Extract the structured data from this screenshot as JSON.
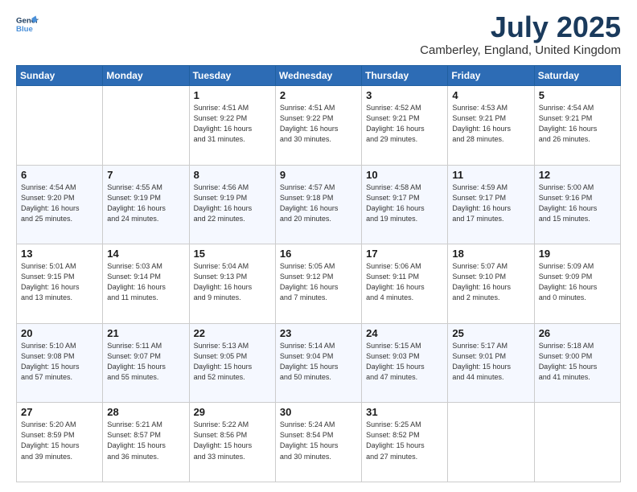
{
  "logo": {
    "line1": "General",
    "line2": "Blue"
  },
  "title": "July 2025",
  "subtitle": "Camberley, England, United Kingdom",
  "weekdays": [
    "Sunday",
    "Monday",
    "Tuesday",
    "Wednesday",
    "Thursday",
    "Friday",
    "Saturday"
  ],
  "weeks": [
    [
      {
        "day": "",
        "info": ""
      },
      {
        "day": "",
        "info": ""
      },
      {
        "day": "1",
        "info": "Sunrise: 4:51 AM\nSunset: 9:22 PM\nDaylight: 16 hours\nand 31 minutes."
      },
      {
        "day": "2",
        "info": "Sunrise: 4:51 AM\nSunset: 9:22 PM\nDaylight: 16 hours\nand 30 minutes."
      },
      {
        "day": "3",
        "info": "Sunrise: 4:52 AM\nSunset: 9:21 PM\nDaylight: 16 hours\nand 29 minutes."
      },
      {
        "day": "4",
        "info": "Sunrise: 4:53 AM\nSunset: 9:21 PM\nDaylight: 16 hours\nand 28 minutes."
      },
      {
        "day": "5",
        "info": "Sunrise: 4:54 AM\nSunset: 9:21 PM\nDaylight: 16 hours\nand 26 minutes."
      }
    ],
    [
      {
        "day": "6",
        "info": "Sunrise: 4:54 AM\nSunset: 9:20 PM\nDaylight: 16 hours\nand 25 minutes."
      },
      {
        "day": "7",
        "info": "Sunrise: 4:55 AM\nSunset: 9:19 PM\nDaylight: 16 hours\nand 24 minutes."
      },
      {
        "day": "8",
        "info": "Sunrise: 4:56 AM\nSunset: 9:19 PM\nDaylight: 16 hours\nand 22 minutes."
      },
      {
        "day": "9",
        "info": "Sunrise: 4:57 AM\nSunset: 9:18 PM\nDaylight: 16 hours\nand 20 minutes."
      },
      {
        "day": "10",
        "info": "Sunrise: 4:58 AM\nSunset: 9:17 PM\nDaylight: 16 hours\nand 19 minutes."
      },
      {
        "day": "11",
        "info": "Sunrise: 4:59 AM\nSunset: 9:17 PM\nDaylight: 16 hours\nand 17 minutes."
      },
      {
        "day": "12",
        "info": "Sunrise: 5:00 AM\nSunset: 9:16 PM\nDaylight: 16 hours\nand 15 minutes."
      }
    ],
    [
      {
        "day": "13",
        "info": "Sunrise: 5:01 AM\nSunset: 9:15 PM\nDaylight: 16 hours\nand 13 minutes."
      },
      {
        "day": "14",
        "info": "Sunrise: 5:03 AM\nSunset: 9:14 PM\nDaylight: 16 hours\nand 11 minutes."
      },
      {
        "day": "15",
        "info": "Sunrise: 5:04 AM\nSunset: 9:13 PM\nDaylight: 16 hours\nand 9 minutes."
      },
      {
        "day": "16",
        "info": "Sunrise: 5:05 AM\nSunset: 9:12 PM\nDaylight: 16 hours\nand 7 minutes."
      },
      {
        "day": "17",
        "info": "Sunrise: 5:06 AM\nSunset: 9:11 PM\nDaylight: 16 hours\nand 4 minutes."
      },
      {
        "day": "18",
        "info": "Sunrise: 5:07 AM\nSunset: 9:10 PM\nDaylight: 16 hours\nand 2 minutes."
      },
      {
        "day": "19",
        "info": "Sunrise: 5:09 AM\nSunset: 9:09 PM\nDaylight: 16 hours\nand 0 minutes."
      }
    ],
    [
      {
        "day": "20",
        "info": "Sunrise: 5:10 AM\nSunset: 9:08 PM\nDaylight: 15 hours\nand 57 minutes."
      },
      {
        "day": "21",
        "info": "Sunrise: 5:11 AM\nSunset: 9:07 PM\nDaylight: 15 hours\nand 55 minutes."
      },
      {
        "day": "22",
        "info": "Sunrise: 5:13 AM\nSunset: 9:05 PM\nDaylight: 15 hours\nand 52 minutes."
      },
      {
        "day": "23",
        "info": "Sunrise: 5:14 AM\nSunset: 9:04 PM\nDaylight: 15 hours\nand 50 minutes."
      },
      {
        "day": "24",
        "info": "Sunrise: 5:15 AM\nSunset: 9:03 PM\nDaylight: 15 hours\nand 47 minutes."
      },
      {
        "day": "25",
        "info": "Sunrise: 5:17 AM\nSunset: 9:01 PM\nDaylight: 15 hours\nand 44 minutes."
      },
      {
        "day": "26",
        "info": "Sunrise: 5:18 AM\nSunset: 9:00 PM\nDaylight: 15 hours\nand 41 minutes."
      }
    ],
    [
      {
        "day": "27",
        "info": "Sunrise: 5:20 AM\nSunset: 8:59 PM\nDaylight: 15 hours\nand 39 minutes."
      },
      {
        "day": "28",
        "info": "Sunrise: 5:21 AM\nSunset: 8:57 PM\nDaylight: 15 hours\nand 36 minutes."
      },
      {
        "day": "29",
        "info": "Sunrise: 5:22 AM\nSunset: 8:56 PM\nDaylight: 15 hours\nand 33 minutes."
      },
      {
        "day": "30",
        "info": "Sunrise: 5:24 AM\nSunset: 8:54 PM\nDaylight: 15 hours\nand 30 minutes."
      },
      {
        "day": "31",
        "info": "Sunrise: 5:25 AM\nSunset: 8:52 PM\nDaylight: 15 hours\nand 27 minutes."
      },
      {
        "day": "",
        "info": ""
      },
      {
        "day": "",
        "info": ""
      }
    ]
  ]
}
